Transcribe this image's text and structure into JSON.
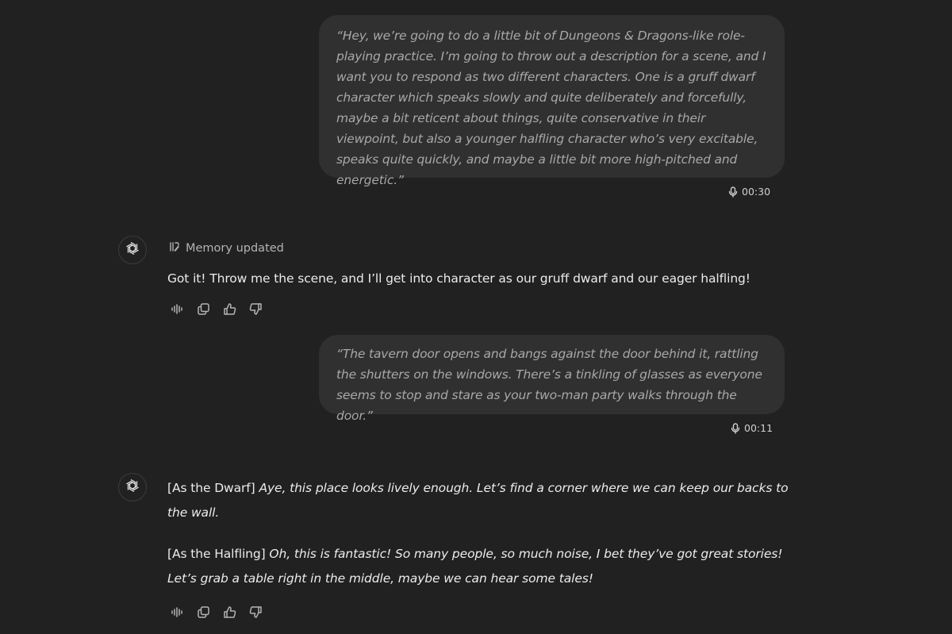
{
  "messages": {
    "user_1": {
      "text": "“Hey, we’re going to do a little bit of Dungeons & Dragons-like role-playing practice. I’m going to throw out a description for a scene, and I want you to respond as two different characters. One is a gruff dwarf character which speaks slowly and quite deliberately and forcefully, maybe a bit reticent about things, quite conservative in their viewpoint, but also a younger halfling character who’s very excitable, speaks quite quickly, and maybe a little bit more high-pitched and energetic.”",
      "duration": "00:30"
    },
    "assistant_1": {
      "memory_note": "Memory updated",
      "text": "Got it! Throw me the scene, and I’ll get into character as our gruff dwarf and our eager halfling!"
    },
    "user_2": {
      "text": "“The tavern door opens and bangs against the door behind it, rattling the shutters on the windows. There’s a tinkling of glasses as everyone seems to stop and stare as your two-man party walks through the door.”",
      "duration": "00:11"
    },
    "assistant_2": {
      "dwarf_tag": "[As the Dwarf]",
      "dwarf_line": "Aye, this place looks lively enough. Let’s find a corner where we can keep our backs to the wall.",
      "halfling_tag": "[As the Halfling]",
      "halfling_line": "Oh, this is fantastic! So many people, so much noise, I bet they’ve got great stories! Let’s grab a table right in the middle, maybe we can hear some tales!"
    }
  },
  "icons": {
    "avatar": "openai-logo-icon",
    "voice": "microphone-icon",
    "memory": "memory-icon",
    "actions": [
      "read-aloud-icon",
      "copy-icon",
      "thumbs-up-icon",
      "thumbs-down-icon"
    ]
  },
  "colors": {
    "background": "#212121",
    "user_bubble": "#303030",
    "user_text": "#a8a8a8",
    "assistant_text": "#ececec",
    "muted": "#b4b4b4"
  }
}
